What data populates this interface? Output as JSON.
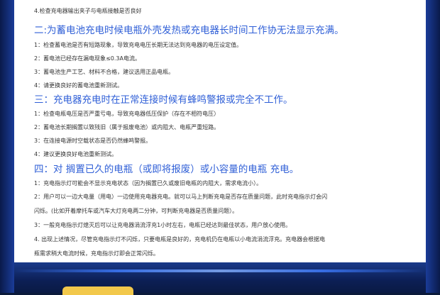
{
  "top_line": "4.检查充电器输出夹子与电瓶接触是否良好",
  "section2": {
    "heading": "二:为蓄电池充电时候电瓶外壳发热或充电器长时间工作协无法显示充满。",
    "items": [
      "1：检查蓄电池是否有短路现象，导致充电电压长期无法达到充电器的电压设定值。",
      "2：蓄电池已经存在漏电现象≤0.3A电流。",
      "3：蓄电池生产工艺、材料不合格，建议选用正品电瓶。",
      "4：请更换良好的蓄电池重新测试。"
    ]
  },
  "section3": {
    "heading": "三：充电器充电时在正常连接时候有蜂鸣警报或完全不工作。",
    "items": [
      "1：检查电瓶电压是否严重亏电，导致充电器低压保护（存在不相符电压）",
      "2：蓄电池长期搁置以致残旧（属于报废电池）或内阻大、电瓶严重短路。",
      "3：在连接电源时空载状态是否仍然蜂鸣警报。",
      "4：建议更换良好电池重新测试。"
    ]
  },
  "section4": {
    "heading": "四：对 搁置已久的电瓶（或即将报废）或小容量的电瓶 充电。",
    "items": [
      "1：充电指示灯可能会不显示充电状态（因为搁置已久或废旧电瓶的内阻大，需求电流小）。",
      "2：用户可以一边大电量（用电）一边使用充电器充电。就可以马上判断充电是否存在质量问题，此时充电指示灯会闪",
      "闪烁。(比如开着摩托车或汽车大灯充电两二分钟，可判断充电器是否质量问题）。",
      "3：一般充电指示灯熄灭后可以让充电器涓流浮充1小时左右，电瓶已经达到最佳状态，用户放心使用。",
      "4. 出现上述情况，尽管充电指示灯不闪烁，只要电瓶是良好的，充电机仍在电瓶以小电流涓流浮充。充电器会根据电",
      "瓶需求稍大电流时候，充电指示灯即会正常闪烁。"
    ]
  }
}
